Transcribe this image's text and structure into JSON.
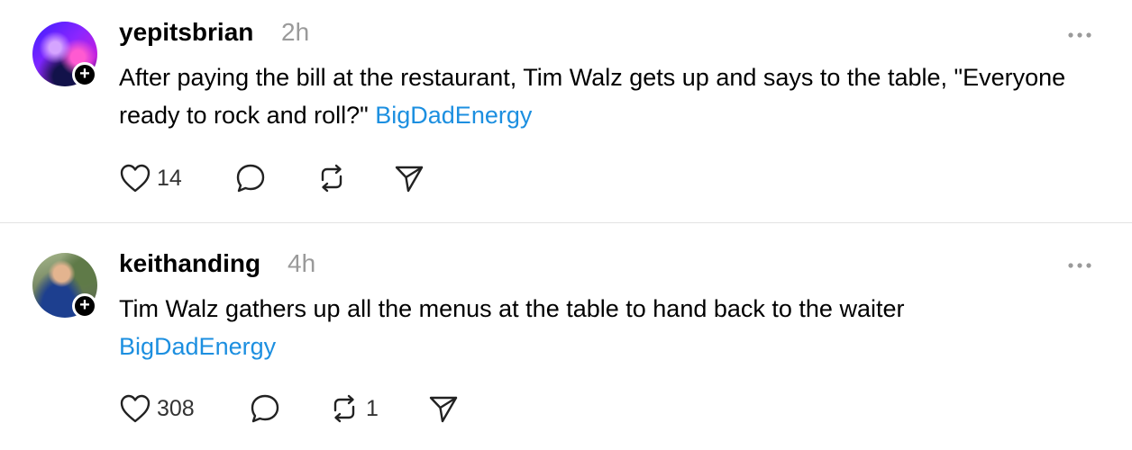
{
  "posts": [
    {
      "username": "yepitsbrian",
      "time": "2h",
      "text": "After paying the bill at the restaurant, Tim Walz gets up and says to the table, \"Everyone ready to rock and roll?\"",
      "hashtag": "BigDadEnergy",
      "likes": "14",
      "replies": "",
      "reposts": "",
      "avatar_icon": "avatar-photo",
      "follow_icon": "plus-icon"
    },
    {
      "username": "keithanding",
      "time": "4h",
      "text": "Tim Walz gathers up all the menus at the table to hand back to the waiter",
      "hashtag": "BigDadEnergy",
      "likes": "308",
      "replies": "",
      "reposts": "1",
      "avatar_icon": "avatar-photo",
      "follow_icon": "plus-icon"
    }
  ],
  "colors": {
    "hashtag": "#1c8fe0",
    "timestamp": "#9a9a9a",
    "divider": "#e3e3e3"
  },
  "icons": [
    "heart-icon",
    "comment-icon",
    "repost-icon",
    "share-icon",
    "more-icon"
  ]
}
